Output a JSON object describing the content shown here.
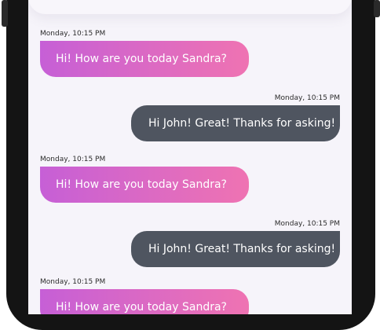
{
  "chat": {
    "messages": [
      {
        "side": "received",
        "time": "Monday, 10:15 PM",
        "text": "Hi! How are you today Sandra?"
      },
      {
        "side": "sent",
        "time": "Monday, 10:15 PM",
        "text": "Hi John! Great! Thanks for asking!"
      },
      {
        "side": "received",
        "time": "Monday, 10:15 PM",
        "text": "Hi! How are you today Sandra?"
      },
      {
        "side": "sent",
        "time": "Monday, 10:15 PM",
        "text": "Hi John! Great! Thanks for asking!"
      },
      {
        "side": "received",
        "time": "Monday, 10:15 PM",
        "text": "Hi! How are you today Sandra?"
      }
    ]
  },
  "colors": {
    "received_gradient_start": "#c65fd6",
    "received_gradient_end": "#ef73b2",
    "sent_bubble": "#4f5560",
    "screen_background": "#f6f4fa"
  }
}
